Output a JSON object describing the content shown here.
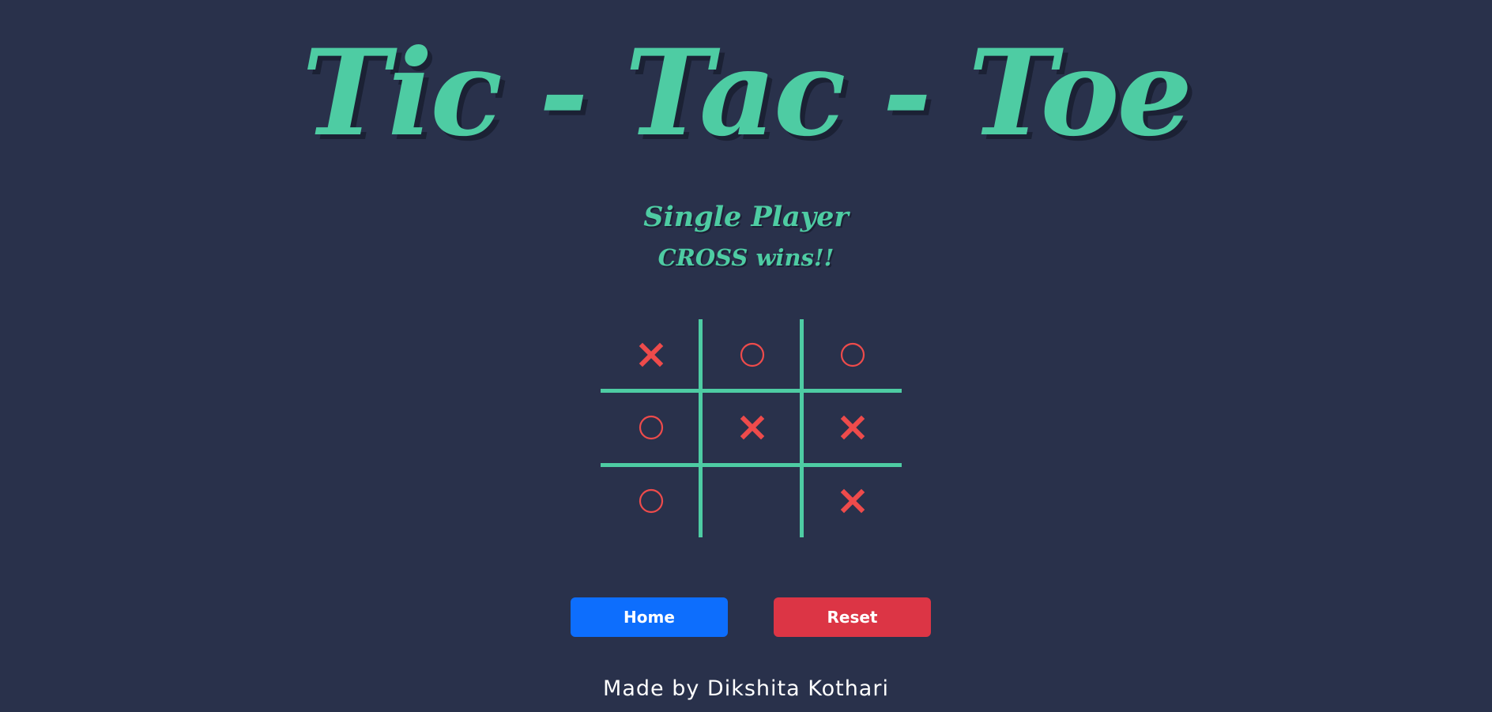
{
  "header": {
    "title": "Tic - Tac - Toe",
    "mode": "Single Player",
    "status": "CROSS wins!!"
  },
  "board": {
    "cells": [
      "X",
      "O",
      "O",
      "O",
      "X",
      "X",
      "O",
      "",
      "X"
    ]
  },
  "controls": {
    "home_label": "Home",
    "reset_label": "Reset"
  },
  "footer": {
    "credit": "Made by Dikshita Kothari"
  },
  "colors": {
    "background": "#29314b",
    "accent": "#4ecca3",
    "mark": "#ee4b4b",
    "home_button": "#0d6efd",
    "reset_button": "#dc3545"
  }
}
